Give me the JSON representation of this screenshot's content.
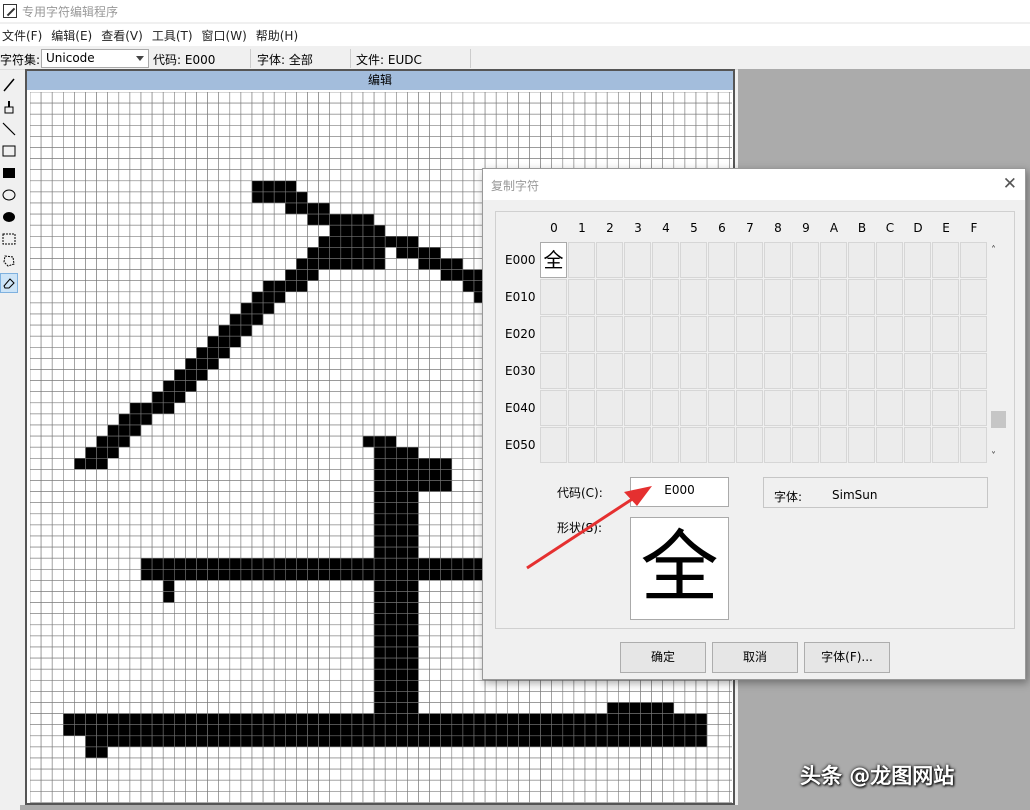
{
  "window": {
    "title": "专用字符编辑程序"
  },
  "menu": [
    "文件(F)",
    "编辑(E)",
    "查看(V)",
    "工具(T)",
    "窗口(W)",
    "帮助(H)"
  ],
  "toolbar": {
    "charset_label": "字符集:",
    "charset_value": "Unicode",
    "code_label": "代码: E000",
    "font_label": "字体: 全部",
    "file_label": "文件: EUDC"
  },
  "tools": [
    "pencil-icon",
    "brush-icon",
    "line-icon",
    "hollow-rectangle-icon",
    "filled-rectangle-icon",
    "hollow-ellipse-icon",
    "filled-ellipse-icon",
    "rectangle-select-icon",
    "freeform-select-icon",
    "eraser-icon"
  ],
  "editor": {
    "title": "编辑",
    "glyph": "全"
  },
  "dialog": {
    "title": "复制字符",
    "close_glyph": "✕",
    "columns": [
      "0",
      "1",
      "2",
      "3",
      "4",
      "5",
      "6",
      "7",
      "8",
      "9",
      "A",
      "B",
      "C",
      "D",
      "E",
      "F"
    ],
    "rows": [
      "E000",
      "E010",
      "E020",
      "E030",
      "E040",
      "E050"
    ],
    "selected_cell_char": "全",
    "code_label": "代码(C):",
    "code_value": "E000",
    "font_label": "字体:",
    "font_value": "SimSun",
    "shape_label": "形状(S):",
    "shape_char": "全",
    "buttons": {
      "ok": "确定",
      "cancel": "取消",
      "font": "字体(F)..."
    },
    "scroll_up": "˄",
    "scroll_down": "˅"
  },
  "watermark": "头条 @龙图网站",
  "colors": {
    "editor_title_bg": "#a3bddc",
    "workspace_bg": "#ababab",
    "pixel_on": "#000000",
    "arrow": "#e53030"
  }
}
